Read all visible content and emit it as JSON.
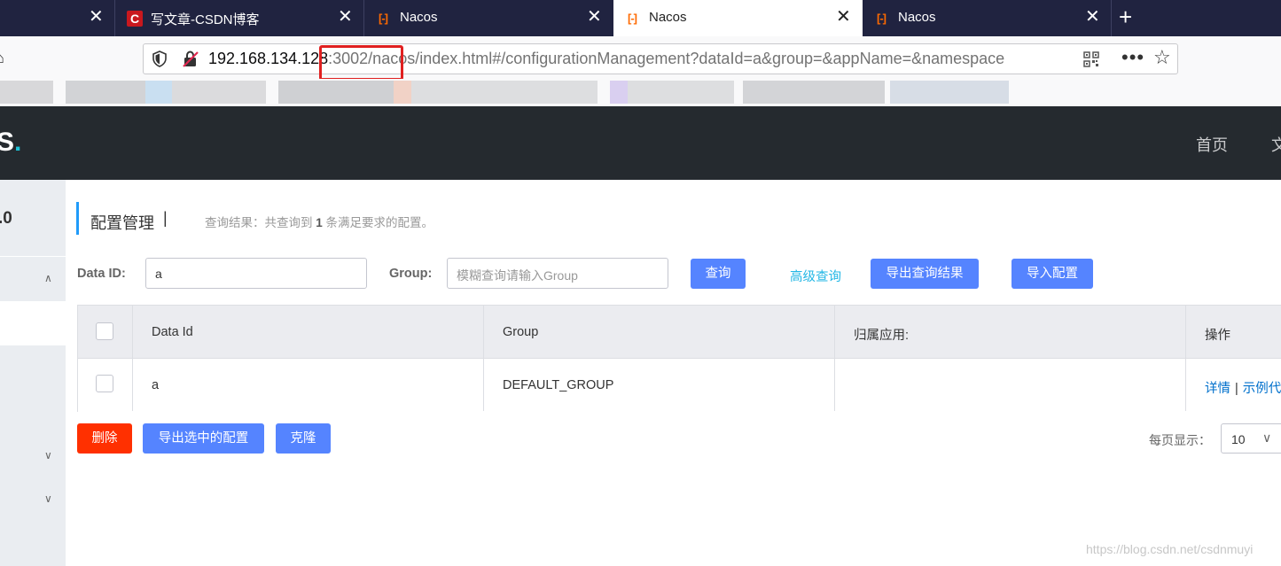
{
  "browser": {
    "tabs": [
      {
        "title": "",
        "favicon": "none",
        "active": false
      },
      {
        "title": "写文章-CSDN博客",
        "favicon": "csdn-icon",
        "active": false
      },
      {
        "title": "Nacos",
        "favicon": "nacos-icon",
        "active": false
      },
      {
        "title": "Nacos",
        "favicon": "nacos-icon",
        "active": true
      },
      {
        "title": "Nacos",
        "favicon": "nacos-icon",
        "active": false
      }
    ],
    "url": {
      "host": "192.168.134.128",
      "path": ":3002/nacos/index.html#/configurationManagement?dataId=a&group=&appName=&namespace"
    },
    "more_label": "•••"
  },
  "header": {
    "logo_tail": "S",
    "logo_dot": ".",
    "nav": [
      "首页",
      "文"
    ]
  },
  "sidebar": {
    "version": ".0"
  },
  "page": {
    "title": "配置管理",
    "title_separator": "|",
    "query_result_prefix": "查询结果：共查询到",
    "query_result_count": "1",
    "query_result_suffix": "条满足要求的配置。"
  },
  "filters": {
    "data_id_label": "Data ID:",
    "data_id_value": "a",
    "group_label": "Group:",
    "group_placeholder": "模糊查询请输入Group",
    "search_button": "查询",
    "advanced_link": "高级查询",
    "export_results_button": "导出查询结果",
    "import_button": "导入配置"
  },
  "table": {
    "columns": [
      "Data Id",
      "Group",
      "归属应用:",
      "操作"
    ],
    "rows": [
      {
        "data_id": "a",
        "group": "DEFAULT_GROUP",
        "app": "",
        "ops": [
          "详情",
          "示例代"
        ]
      }
    ]
  },
  "bulk_actions": {
    "delete": "删除",
    "export_selected": "导出选中的配置",
    "clone": "克隆"
  },
  "pagination": {
    "page_size_label": "每页显示：",
    "page_size": "10"
  },
  "watermark": "https://blog.csdn.net/csdnmuyi",
  "colors": {
    "header_bg": "#252a2f",
    "primary": "#5584ff",
    "danger": "#ff3000",
    "link": "#23b7e5",
    "op_link": "#0070cc",
    "tab_strip": "#202340",
    "url_highlight": "#e02020"
  }
}
